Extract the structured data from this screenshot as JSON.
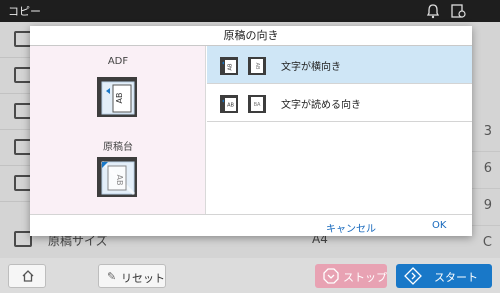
{
  "topbar": {
    "title": "コピー"
  },
  "background": {
    "rows": [
      {
        "label": "",
        "value": ""
      },
      {
        "label": "",
        "value": ""
      },
      {
        "label": "",
        "value": ""
      },
      {
        "label": "",
        "value": ""
      },
      {
        "label": "",
        "value": ""
      },
      {
        "label": "原稿サイズ",
        "value": "A4"
      }
    ],
    "keypad": [
      "3",
      "6",
      "9",
      "C"
    ]
  },
  "dialog": {
    "title": "原稿の向き",
    "adf_label": "ADF",
    "platen_label": "原稿台",
    "options": [
      {
        "label": "文字が横向き",
        "selected": true
      },
      {
        "label": "文字が読める向き",
        "selected": false
      }
    ],
    "cancel_label": "キャンセル",
    "ok_label": "OK"
  },
  "bottombar": {
    "reset_label": "リセット",
    "stop_label": "ストップ",
    "start_label": "スタート"
  },
  "colors": {
    "selected_row": "#cfe6f6",
    "left_pane": "#faf0f6",
    "link": "#1769bd",
    "stop": "#e8a2b3",
    "start": "#1978c8"
  }
}
